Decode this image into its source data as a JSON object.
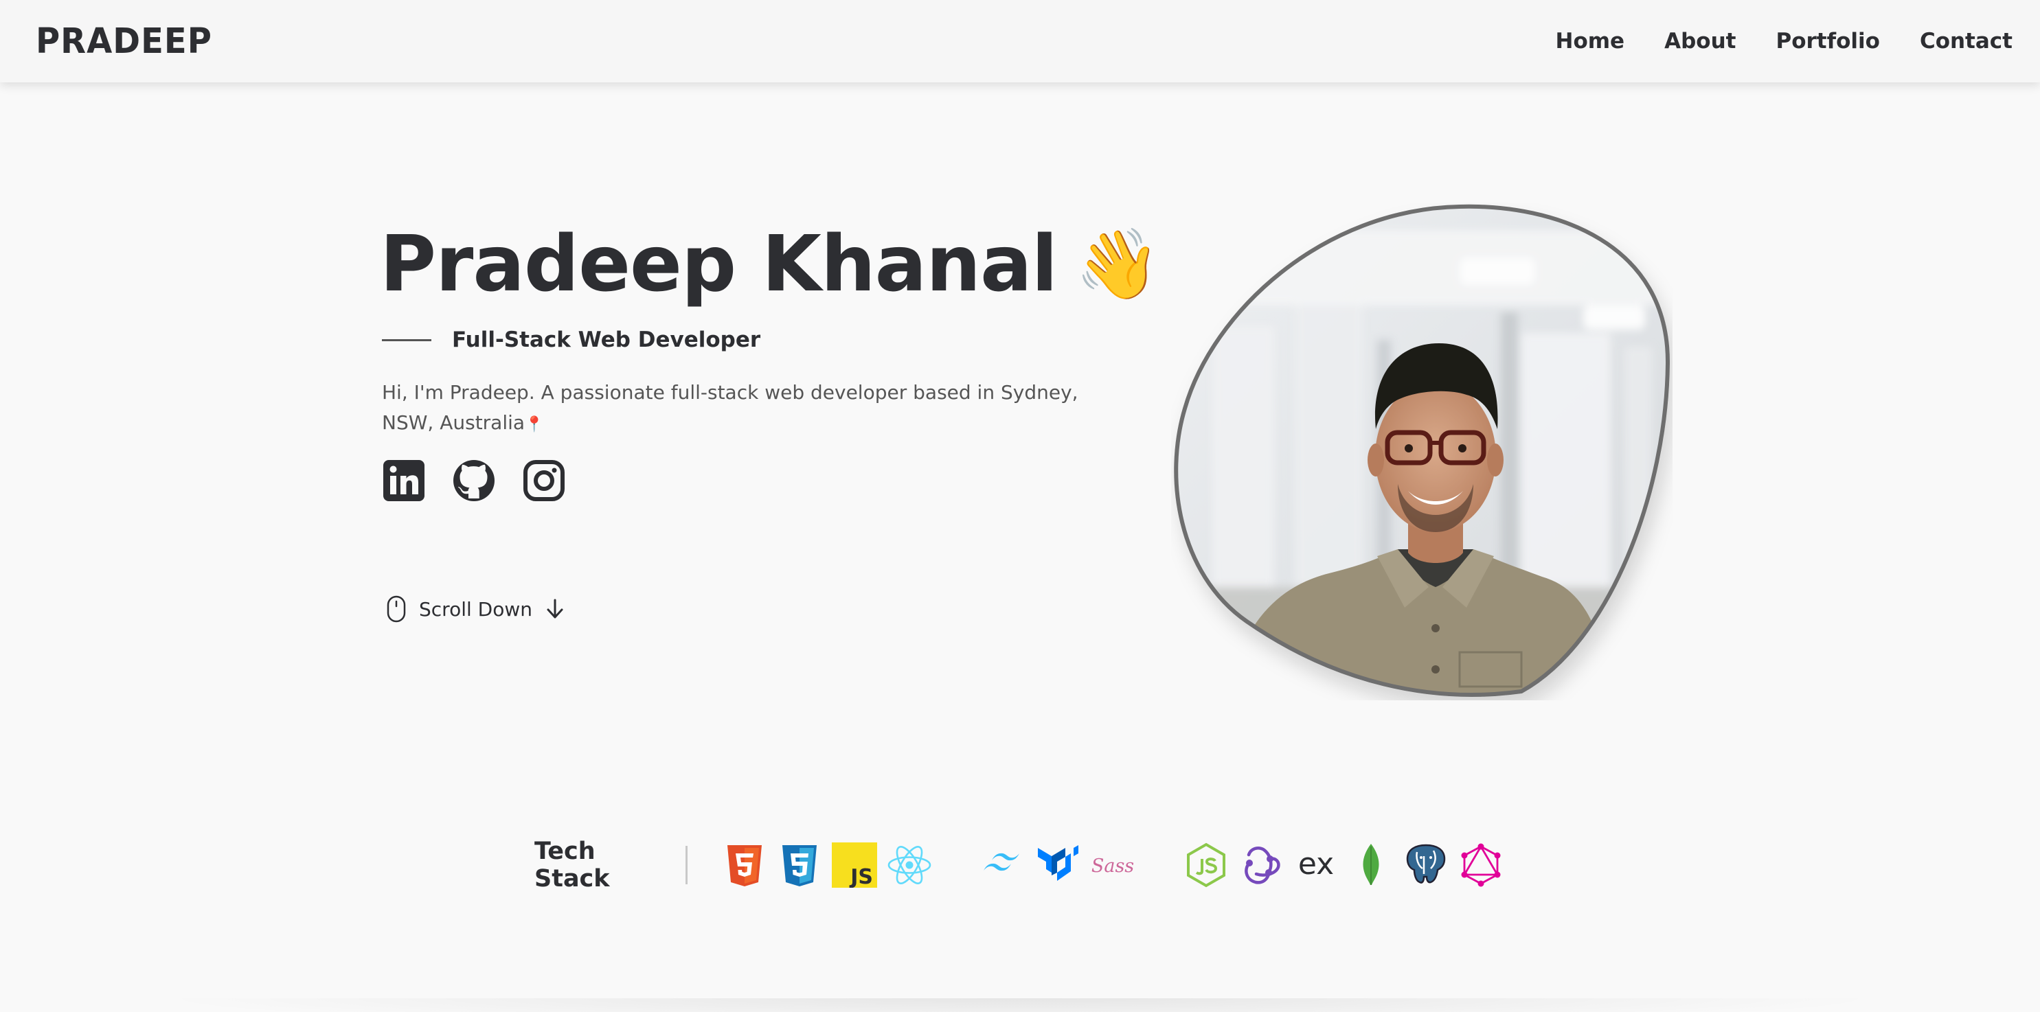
{
  "header": {
    "logo": "PRADEEP",
    "nav": [
      {
        "label": "Home"
      },
      {
        "label": "About"
      },
      {
        "label": "Portfolio"
      },
      {
        "label": "Contact"
      }
    ]
  },
  "hero": {
    "name": "Pradeep Khanal",
    "wave_emoji": "👋",
    "role": "Full-Stack Web Developer",
    "bio": "Hi, I'm Pradeep. A passionate full-stack web developer based in Sydney, NSW, Australia",
    "pin_emoji": "📍",
    "socials": [
      {
        "icon": "linkedin-icon"
      },
      {
        "icon": "github-icon"
      },
      {
        "icon": "instagram-icon"
      }
    ],
    "scroll_label": "Scroll Down"
  },
  "tech_stack": {
    "title": "Tech Stack",
    "js_label": "JS",
    "sass_label": "Sass",
    "express_label": "ex",
    "icons": [
      "html5-icon",
      "css3-icon",
      "javascript-icon",
      "react-icon",
      "tailwind-icon",
      "mui-icon",
      "sass-icon",
      "nodejs-icon",
      "redux-icon",
      "express-icon",
      "mongodb-icon",
      "postgresql-icon",
      "graphql-icon"
    ]
  },
  "colors": {
    "text": "#2d2e32",
    "background": "#f9f9f9",
    "html5": "#e44d26",
    "css3": "#1572b6",
    "javascript": "#f7df1e",
    "react": "#61dafb",
    "tailwind": "#38bdf8",
    "mui": "#007fff",
    "sass": "#cd6799",
    "nodejs": "#8cc84b",
    "redux": "#764abc",
    "mongodb": "#4faa41",
    "postgresql": "#336791",
    "graphql": "#e10098"
  }
}
